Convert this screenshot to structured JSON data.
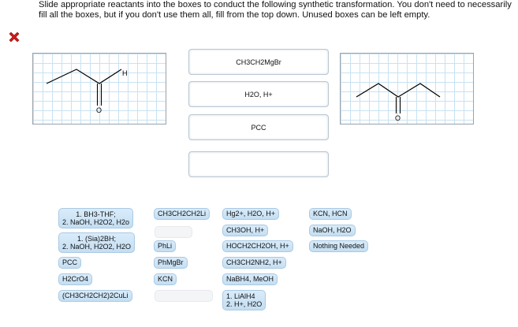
{
  "instructions": "Slide appropriate reactants into the boxes to conduct the following synthetic transformation. You don't need to necessarily fill all the boxes, but if you don't use them all, fill from the top down.  Unused boxes can be left empty.",
  "status": {
    "icon": "red-x-icon",
    "color": "#d11a1a"
  },
  "start_molecule": {
    "atom_label_H": "H",
    "atom_label_O": "O"
  },
  "product_molecule": {
    "atom_label_O": "O"
  },
  "slots": [
    {
      "value": "CH3CH2MgBr"
    },
    {
      "value": "H2O, H+"
    },
    {
      "value": "PCC"
    },
    {
      "value": ""
    }
  ],
  "reagents": {
    "bh3": {
      "line1": "1. BH3-THF;",
      "line2": "2. NaOH, H2O2, H2o"
    },
    "sia2bh": {
      "line1": "1. (Sia)2BH;",
      "line2": "2. NaOH, H2O2, H2O"
    },
    "pcc": "PCC",
    "h2cro4": "H2CrO4",
    "cuprate": "(CH3CH2CH2)2CuLi",
    "ch3ch2ch2li": "CH3CH2CH2Li",
    "phli": "PhLi",
    "phmgbr": "PhMgBr",
    "kcn": "KCN",
    "hg2": "Hg2+, H2O, H+",
    "ch3oh": "CH3OH, H+",
    "hoch2ch2oh": "HOCH2CH2OH, H+",
    "ch3ch2nh2": "CH3CH2NH2, H+",
    "nabh4": "NaBH4, MeOH",
    "lialh4": {
      "line1": "1. LiAlH4",
      "line2": "2. H+, H2O"
    },
    "kcn_hcn": "KCN, HCN",
    "naoh_h2o": "NaOH, H2O",
    "nothing": "Nothing Needed"
  }
}
